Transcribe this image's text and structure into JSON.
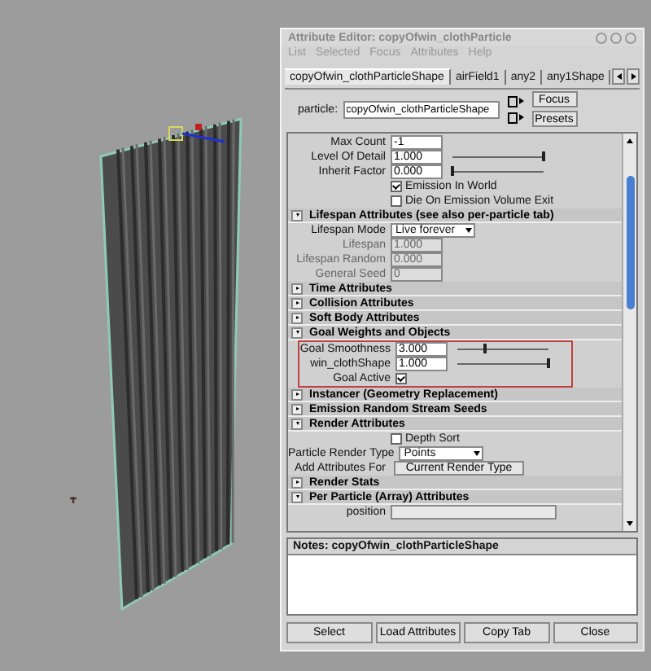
{
  "window": {
    "title": "Attribute Editor: copyOfwin_clothParticle",
    "menu": [
      "List",
      "Selected",
      "Focus",
      "Attributes",
      "Help"
    ]
  },
  "tabs": [
    {
      "label": "copyOfwin_clothParticleShape",
      "selected": true
    },
    {
      "label": "airField1",
      "selected": false
    },
    {
      "label": "any2",
      "selected": false
    },
    {
      "label": "any1Shape",
      "selected": false
    }
  ],
  "node": {
    "label": "particle:",
    "value": "copyOfwin_clothParticleShape",
    "buttons": [
      "Focus",
      "Presets"
    ]
  },
  "rows": [
    {
      "kind": "field",
      "label": "Max Count",
      "value": "-1",
      "disabled": false
    },
    {
      "kind": "slider",
      "label": "Level Of Detail",
      "value": "1.000",
      "level": 1,
      "disabled": false
    },
    {
      "kind": "slider",
      "label": "Inherit Factor",
      "value": "0.000",
      "level": 0,
      "disabled": false
    },
    {
      "kind": "checkbox",
      "label": "Emission In World",
      "checked": true
    },
    {
      "kind": "checkbox",
      "label": "Die On Emission Volume Exit",
      "checked": false
    },
    {
      "kind": "section",
      "label": "Lifespan Attributes (see also per-particle tab)",
      "expanded": true
    },
    {
      "kind": "dropdown",
      "label": "Lifespan Mode",
      "value": "Live forever"
    },
    {
      "kind": "field",
      "label": "Lifespan",
      "value": "1.000",
      "disabled": true
    },
    {
      "kind": "field",
      "label": "Lifespan Random",
      "value": "0.000",
      "disabled": true
    },
    {
      "kind": "field",
      "label": "General Seed",
      "value": "0",
      "disabled": true
    },
    {
      "kind": "section",
      "label": "Time Attributes",
      "expanded": false
    },
    {
      "kind": "section",
      "label": "Collision Attributes",
      "expanded": false
    },
    {
      "kind": "section",
      "label": "Soft Body Attributes",
      "expanded": false
    },
    {
      "kind": "section",
      "label": "Goal Weights and Objects",
      "expanded": true
    },
    {
      "kind": "group",
      "highlighted": true,
      "rows": [
        {
          "kind": "slider",
          "label": "Goal Smoothness",
          "value": "3.000",
          "level": 0.3,
          "disabled": false
        },
        {
          "kind": "slider",
          "label": "win_clothShape",
          "value": "1.000",
          "level": 1,
          "disabled": false
        },
        {
          "kind": "checkbox_left",
          "label": "Goal Active",
          "checked": true
        }
      ]
    },
    {
      "kind": "section",
      "label": "Instancer (Geometry Replacement)",
      "expanded": false
    },
    {
      "kind": "section",
      "label": "Emission Random Stream Seeds",
      "expanded": false
    },
    {
      "kind": "section",
      "label": "Render Attributes",
      "expanded": true
    },
    {
      "kind": "checkbox",
      "label": "Depth Sort",
      "checked": false
    },
    {
      "kind": "dropdown",
      "label": "Particle Render Type",
      "value": "Points"
    },
    {
      "kind": "button",
      "label": "Add Attributes For",
      "value": "Current Render Type"
    },
    {
      "kind": "section",
      "label": "Render Stats",
      "expanded": false
    },
    {
      "kind": "section",
      "label": "Per Particle (Array) Attributes",
      "expanded": true
    },
    {
      "kind": "field_wide",
      "label": "position"
    }
  ],
  "notes": {
    "label": "Notes: copyOfwin_clothParticleShape"
  },
  "buttons": [
    "Select",
    "Load Attributes",
    "Copy Tab",
    "Close"
  ]
}
